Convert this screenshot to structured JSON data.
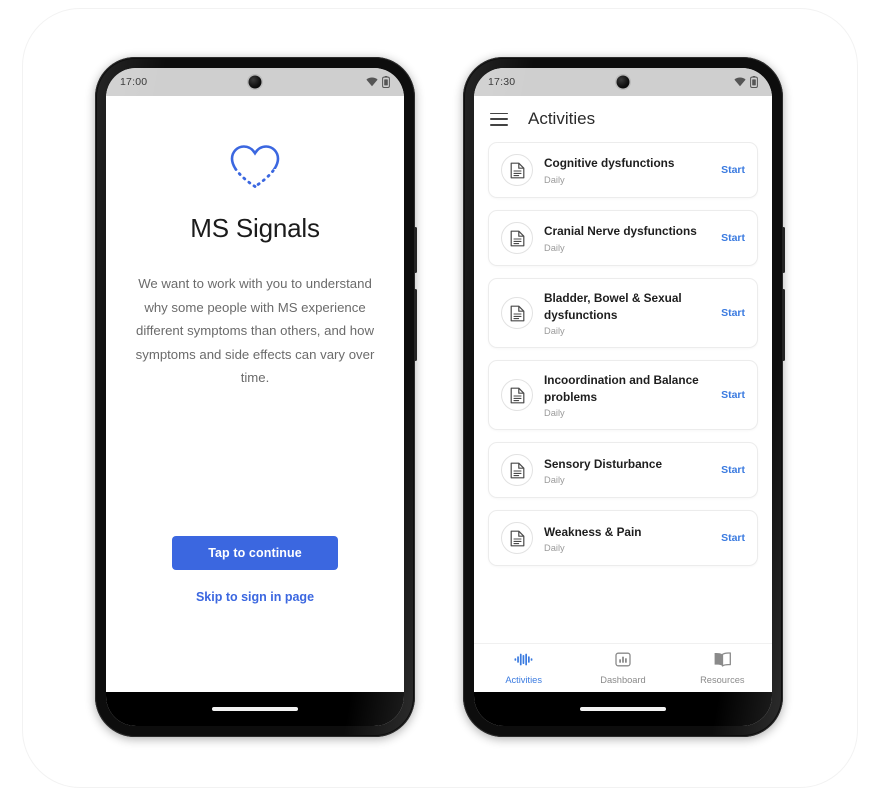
{
  "phones": [
    {
      "name": "welcome-screen",
      "status_bar": {
        "time": "17:00",
        "wifi_icon": "wifi-icon",
        "battery_icon": "battery-icon"
      },
      "logo_icon": "heart-dashed-icon",
      "app_title": "MS Signals",
      "body_text": "We want to work with you to understand why some people with MS experience different symptoms than others, and how symptoms and side effects can vary over time.",
      "primary_button": "Tap to continue",
      "secondary_link": "Skip to sign in page"
    },
    {
      "name": "activities-screen",
      "status_bar": {
        "time": "17:30",
        "wifi_icon": "wifi-icon",
        "battery_icon": "battery-icon"
      },
      "appbar": {
        "menu_icon": "hamburger-menu-icon",
        "title": "Activities"
      },
      "activities": [
        {
          "icon": "document-icon",
          "title": "Cognitive dysfunctions",
          "frequency": "Daily",
          "action": "Start"
        },
        {
          "icon": "document-icon",
          "title": "Cranial Nerve dysfunctions",
          "frequency": "Daily",
          "action": "Start"
        },
        {
          "icon": "document-icon",
          "title": "Bladder, Bowel & Sexual dysfunctions",
          "frequency": "Daily",
          "action": "Start"
        },
        {
          "icon": "document-icon",
          "title": "Incoordination and Balance problems",
          "frequency": "Daily",
          "action": "Start"
        },
        {
          "icon": "document-icon",
          "title": "Sensory Disturbance",
          "frequency": "Daily",
          "action": "Start"
        },
        {
          "icon": "document-icon",
          "title": "Weakness & Pain",
          "frequency": "Daily",
          "action": "Start"
        }
      ],
      "bottom_nav": [
        {
          "icon": "waveform-icon",
          "label": "Activities",
          "active": true
        },
        {
          "icon": "bar-chart-icon",
          "label": "Dashboard",
          "active": false
        },
        {
          "icon": "open-book-icon",
          "label": "Resources",
          "active": false
        }
      ]
    }
  ],
  "colors": {
    "accent_blue": "#3b67e0",
    "link_blue": "#3b7be0",
    "status_bar_gray": "#cfcfcf",
    "body_text_gray": "#6b6b6b",
    "bezel_black": "#0d0d0d"
  }
}
